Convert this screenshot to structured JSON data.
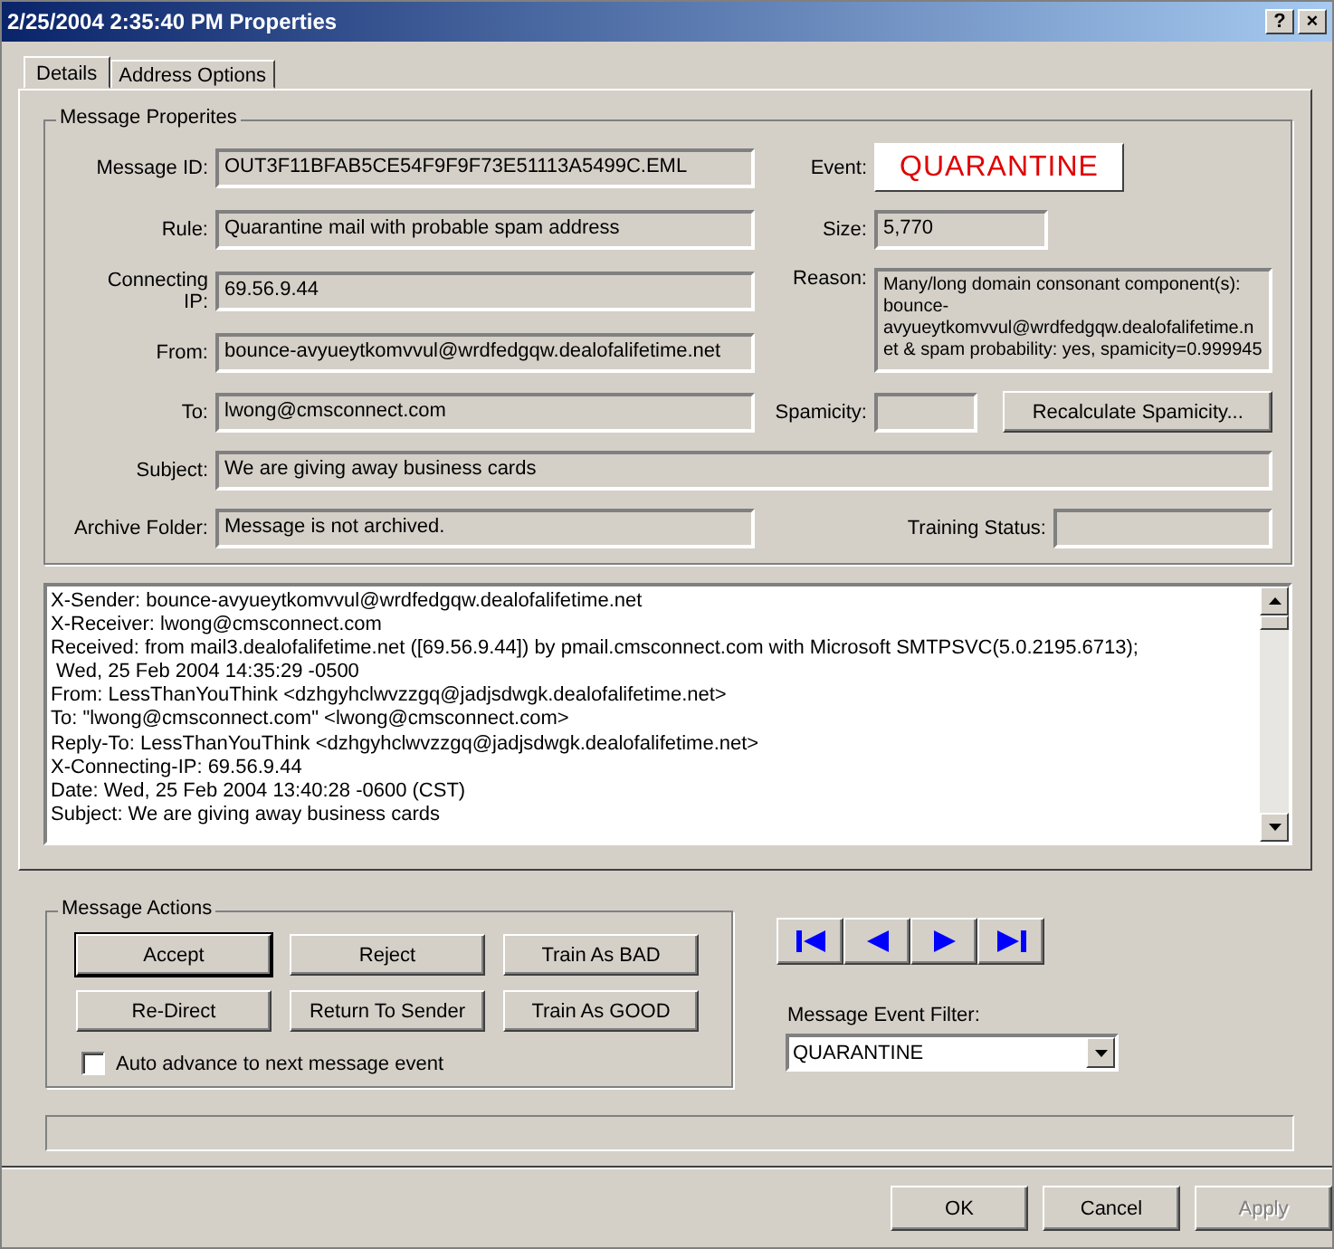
{
  "window": {
    "title": "2/25/2004 2:35:40 PM Properties",
    "help_button": "?",
    "close_button": "×"
  },
  "tabs": [
    {
      "label": "Details",
      "selected": true
    },
    {
      "label": "Address Options",
      "selected": false
    }
  ],
  "message_properties": {
    "title": "Message Properites",
    "message_id": {
      "label": "Message ID:",
      "value": "OUT3F11BFAB5CE54F9F9F73E51113A5499C.EML"
    },
    "rule": {
      "label": "Rule:",
      "value": "Quarantine mail with probable spam address"
    },
    "connecting_ip": {
      "label": "Connecting IP:",
      "value": "69.56.9.44"
    },
    "from": {
      "label": "From:",
      "value": "bounce-avyueytkomvvul@wrdfedgqw.dealofalifetime.net"
    },
    "to": {
      "label": "To:",
      "value": "lwong@cmsconnect.com"
    },
    "subject": {
      "label": "Subject:",
      "value": "We are giving away business cards"
    },
    "archive_folder": {
      "label": "Archive Folder:",
      "value": "Message is not archived."
    },
    "event": {
      "label": "Event:",
      "value": "QUARANTINE"
    },
    "size": {
      "label": "Size:",
      "value": "5,770"
    },
    "reason": {
      "label": "Reason:",
      "value": "Many/long domain consonant component(s): bounce-avyueytkomvvul@wrdfedgqw.dealofalifetime.net & spam probability: yes, spamicity=0.999945"
    },
    "spamicity": {
      "label": "Spamicity:"
    },
    "recalculate_button": "Recalculate Spamicity...",
    "training_status": {
      "label": "Training Status:"
    }
  },
  "headers": [
    "X-Sender: bounce-avyueytkomvvul@wrdfedgqw.dealofalifetime.net",
    "X-Receiver: lwong@cmsconnect.com",
    "Received: from mail3.dealofalifetime.net ([69.56.9.44]) by pmail.cmsconnect.com with Microsoft SMTPSVC(5.0.2195.6713);",
    " Wed, 25 Feb 2004 14:35:29 -0500",
    "From: LessThanYouThink <dzhgyhclwvzzgq@jadjsdwgk.dealofalifetime.net>",
    "To: \"lwong@cmsconnect.com\" <lwong@cmsconnect.com>",
    "Reply-To: LessThanYouThink <dzhgyhclwvzzgq@jadjsdwgk.dealofalifetime.net>",
    "X-Connecting-IP: 69.56.9.44",
    "Date: Wed, 25 Feb 2004 13:40:28 -0600 (CST)",
    "Subject: We are giving away business cards"
  ],
  "message_actions": {
    "title": "Message Actions",
    "buttons": [
      {
        "label": "Accept",
        "focused": true
      },
      {
        "label": "Reject",
        "focused": false
      },
      {
        "label": "Train As BAD",
        "focused": false
      },
      {
        "label": "Re-Direct",
        "focused": false
      },
      {
        "label": "Return To Sender",
        "focused": false
      },
      {
        "label": "Train As GOOD",
        "focused": false
      }
    ],
    "auto_advance": {
      "label": "Auto advance to next message event",
      "checked": false
    }
  },
  "filter": {
    "label": "Message Event Filter:",
    "value": "QUARANTINE"
  },
  "buttons": [
    {
      "label": "OK",
      "disabled": false
    },
    {
      "label": "Cancel",
      "disabled": false
    },
    {
      "label": "Apply",
      "disabled": true
    }
  ]
}
